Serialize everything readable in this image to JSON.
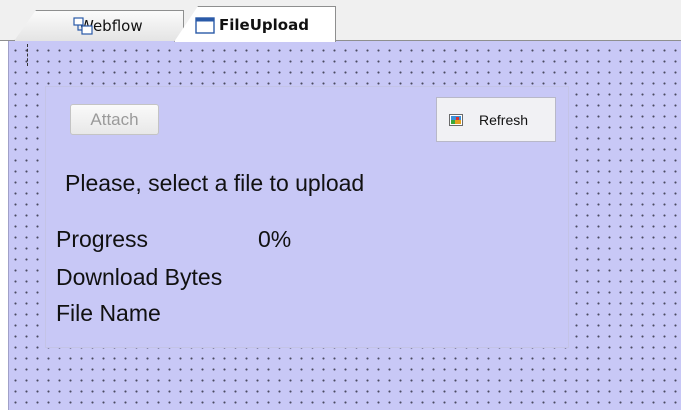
{
  "tabs": [
    {
      "label": "Webflow",
      "icon": "workflow-icon",
      "active": false
    },
    {
      "label": "FileUpload",
      "icon": "form-window-icon",
      "active": true
    }
  ],
  "form": {
    "attach_button": {
      "label": "Attach",
      "enabled": false
    },
    "refresh_button": {
      "label": "Refresh",
      "icon": "refresh-image-icon"
    },
    "instruction": "Please, select a file to upload",
    "progress": {
      "label": "Progress",
      "value": "0%"
    },
    "download_bytes": {
      "label": "Download Bytes"
    },
    "file_name": {
      "label": "File Name"
    }
  },
  "colors": {
    "canvas_background": "#c8c8f6",
    "grid_dots": "#4a4a60",
    "tab_strip": "#f0f0f0",
    "button_disabled_text": "#9a9a9a"
  }
}
